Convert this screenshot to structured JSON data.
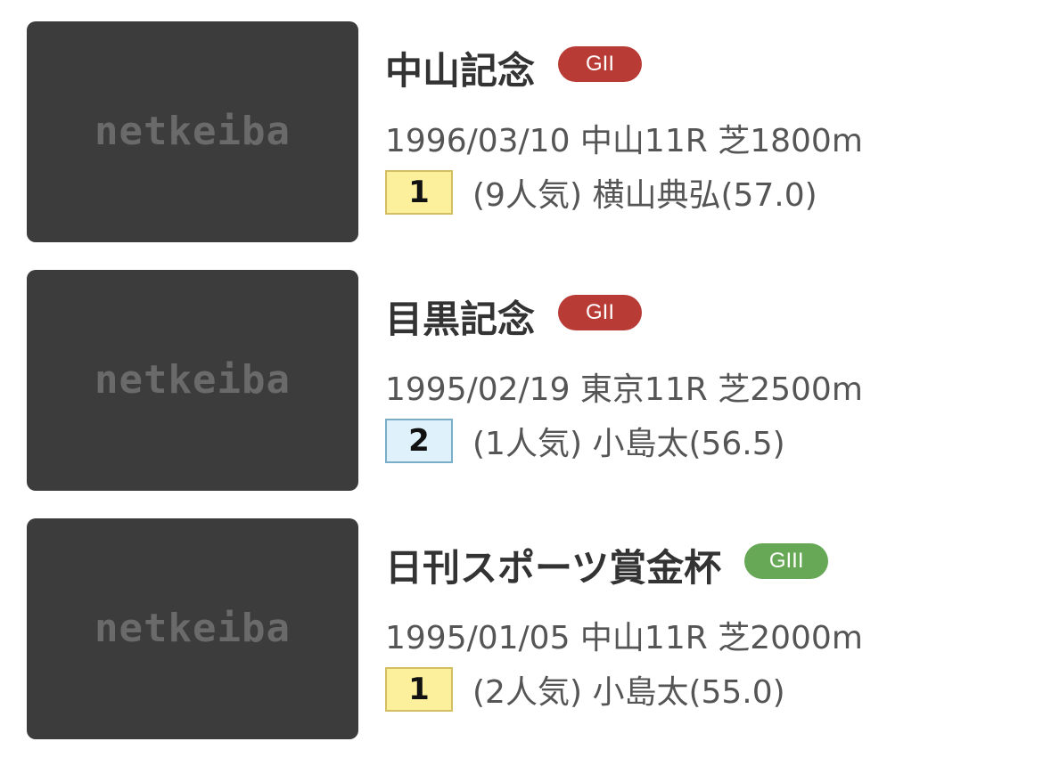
{
  "colors": {
    "thumb_bg": "#3c3c3c",
    "thumb_logo": "#6a6a6a",
    "gii_badge": "#b93b36",
    "giii_badge": "#67a857",
    "rank1_bg": "#fdf09c",
    "rank1_border": "#d4be62",
    "rank2_bg": "#dff2fb",
    "rank2_border": "#7aaec8"
  },
  "races": [
    {
      "thumbnail_text": "netkeiba",
      "name": "中山記念",
      "grade": "GII",
      "grade_color": "#b93b36",
      "meta": "1996/03/10 中山11R 芝1800m",
      "rank": "1",
      "rank_bg": "#fdf09c",
      "rank_border": "#d4be62",
      "result": "(9人気) 横山典弘(57.0)"
    },
    {
      "thumbnail_text": "netkeiba",
      "name": "目黒記念",
      "grade": "GII",
      "grade_color": "#b93b36",
      "meta": "1995/02/19 東京11R 芝2500m",
      "rank": "2",
      "rank_bg": "#dff2fb",
      "rank_border": "#7aaec8",
      "result": "(1人気) 小島太(56.5)"
    },
    {
      "thumbnail_text": "netkeiba",
      "name": "日刊スポーツ賞金杯",
      "grade": "GIII",
      "grade_color": "#67a857",
      "meta": "1995/01/05 中山11R 芝2000m",
      "rank": "1",
      "rank_bg": "#fdf09c",
      "rank_border": "#d4be62",
      "result": "(2人気) 小島太(55.0)"
    }
  ]
}
